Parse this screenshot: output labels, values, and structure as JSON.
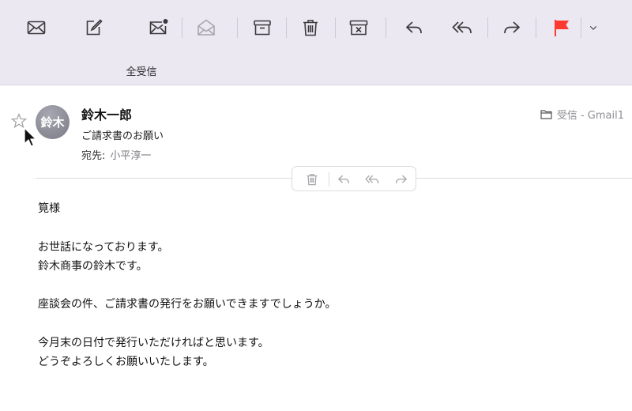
{
  "toolbar": {
    "buttons": [
      {
        "name": "get-mail",
        "icon": "envelope-icon"
      },
      {
        "name": "compose",
        "icon": "compose-icon"
      },
      {
        "name": "mark-unread",
        "icon": "envelope-dot-icon"
      },
      {
        "name": "mark-read",
        "icon": "envelope-open-icon"
      },
      {
        "name": "archive",
        "icon": "archive-icon"
      },
      {
        "name": "delete",
        "icon": "trash-icon"
      },
      {
        "name": "junk",
        "icon": "junk-box-icon"
      },
      {
        "name": "reply",
        "icon": "reply-icon"
      },
      {
        "name": "reply-all",
        "icon": "reply-all-icon"
      },
      {
        "name": "forward",
        "icon": "forward-icon"
      },
      {
        "name": "flag",
        "icon": "flag-icon"
      },
      {
        "name": "flag-menu",
        "icon": "chevron-down-icon"
      }
    ],
    "mailbox_label": "全受信",
    "flag_color": "#ff3b30"
  },
  "message": {
    "avatar_initials": "鈴木",
    "sender": "鈴木一郎",
    "subject": "ご請求書のお願い",
    "to_label": "宛先:",
    "to_name": "小平淳一",
    "folder": "受信 - Gmail1"
  },
  "body_lines": [
    "筧様",
    "",
    "お世話になっております。",
    "鈴木商事の鈴木です。",
    "",
    "座談会の件、ご請求書の発行をお願いできますでしょうか。",
    "",
    "今月末の日付で発行いただければと思います。",
    "どうぞよろしくお願いいたします。"
  ],
  "colors": {
    "toolbar_bg": "#ebe8f1",
    "icon": "#3a3a3c",
    "icon_disabled": "#b5b2bc",
    "muted_text": "#8e8e93"
  }
}
